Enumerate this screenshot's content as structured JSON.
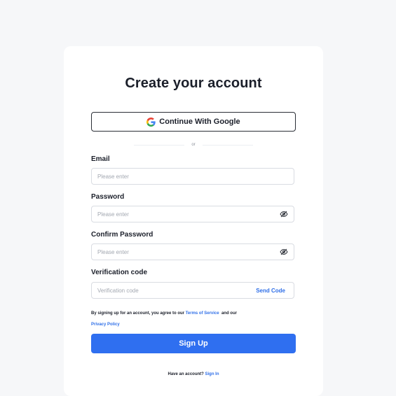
{
  "signup": {
    "title": "Create your account",
    "google_button_label": "Continue With Google",
    "divider_text": "or",
    "email": {
      "label": "Email",
      "placeholder": "Please enter",
      "value": ""
    },
    "password": {
      "label": "Password",
      "placeholder": "Please enter",
      "value": ""
    },
    "confirm_password": {
      "label": "Confirm Password",
      "placeholder": "Please enter",
      "value": ""
    },
    "verification": {
      "label": "Verification code",
      "placeholder": "Verification code",
      "value": "",
      "send_code_label": "Send Code"
    },
    "agreement": {
      "prefix": "By signing up for an account, you agree to our",
      "terms_link": "Terms of Service",
      "middle": "and our",
      "privacy_link": "Privacy Policy"
    },
    "submit_label": "Sign Up",
    "footer": {
      "prompt": "Have an account?",
      "signin_link": "Sign In"
    }
  },
  "icons": {
    "google": "google-icon",
    "password_eye": "eye-off-icon",
    "confirm_eye": "eye-off-icon"
  },
  "colors": {
    "page_background": "#f6f7f9",
    "card_background": "#ffffff",
    "primary": "#2f6ff0",
    "link": "#2f6fe8",
    "text": "#1b1f2a",
    "input_border": "#d9dce2"
  }
}
